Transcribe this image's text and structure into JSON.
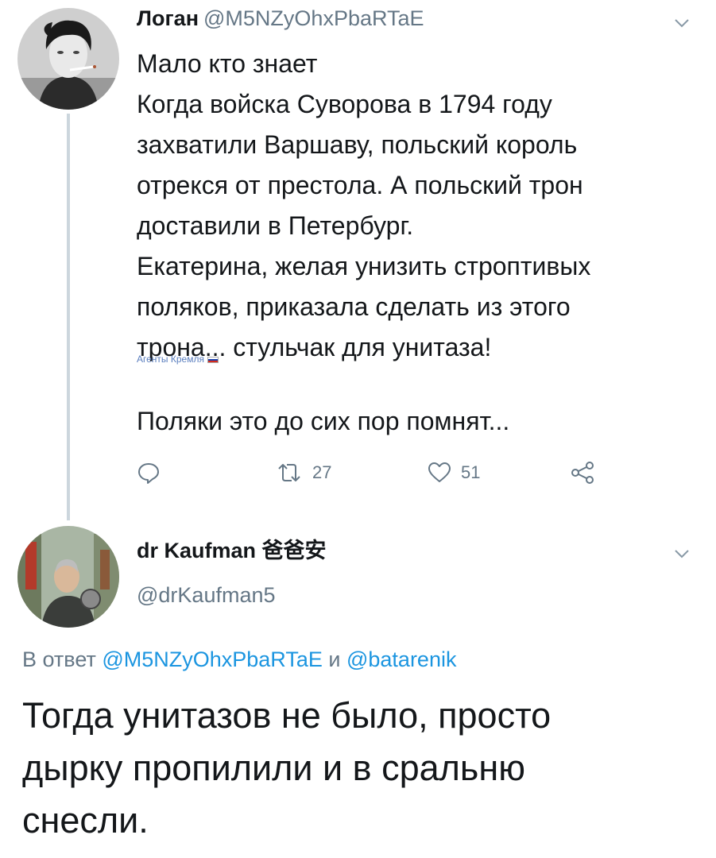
{
  "tweet": {
    "author_name": "Логан",
    "author_handle": "@M5NZyOhxPbaRTaE",
    "lines": [
      "Мало кто знает",
      "Когда войска Суворова в 1794 году",
      "захватили Варшаву, польский король",
      "отрекся от престола. А польский трон",
      "доставили в Петербург.",
      "Екатерина, желая унизить строптивых",
      "поляков, приказала сделать из этого",
      "трона... стульчак для унитаза!"
    ],
    "watermark": "Агенты Кремля",
    "last_line": "Поляки это до сих пор помнят...",
    "actions": {
      "reply_icon": "reply-icon",
      "retweet_icon": "retweet-icon",
      "retweet_count": "27",
      "like_icon": "heart-icon",
      "like_count": "51",
      "share_icon": "share-icon"
    }
  },
  "reply": {
    "author_name": "dr Kaufman 爸爸安",
    "author_handle": "@drKaufman5",
    "reply_to_prefix": "В ответ",
    "reply_to_user1": "@M5NZyOhxPbaRTaE",
    "reply_to_and": "и",
    "reply_to_user2": "@batarenik",
    "lines": [
      "Тогда унитазов не было, просто",
      "дырку пропилили и в сральню",
      "снесли."
    ]
  },
  "colors": {
    "text": "#14171a",
    "secondary": "#657786",
    "link": "#1b95e0",
    "thread_line": "#ccd6dd"
  }
}
